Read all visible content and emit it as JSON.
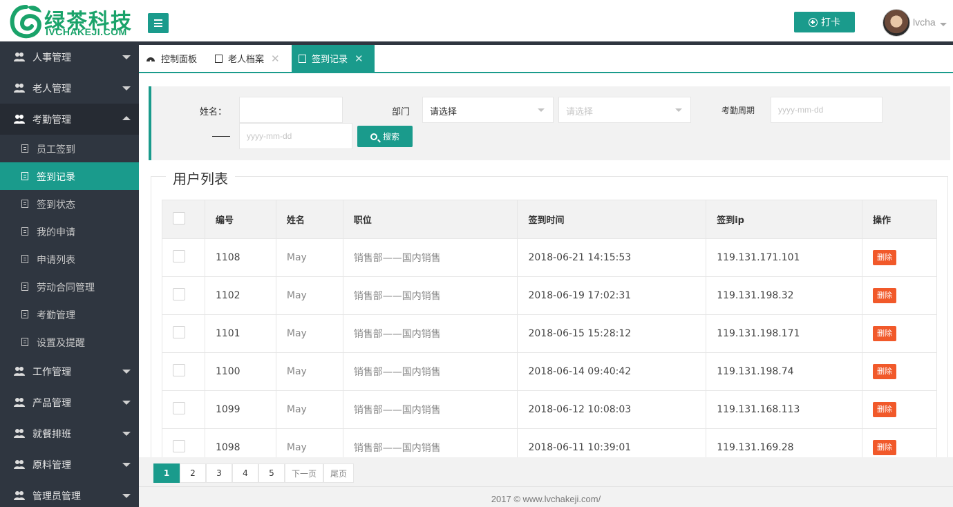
{
  "brand": {
    "name_cn": "绿茶科技",
    "name_en": "IVCHAKEJI.COM",
    "color": "#1aa36a"
  },
  "accent": "#1a9b8c",
  "header": {
    "punch_label": "打卡",
    "username": "lvcha"
  },
  "sidebar": {
    "groups": [
      {
        "label": "人事管理"
      },
      {
        "label": "老人管理"
      },
      {
        "label": "考勤管理"
      },
      {
        "label": "工作管理"
      },
      {
        "label": "产品管理"
      },
      {
        "label": "就餐排班"
      },
      {
        "label": "原料管理"
      },
      {
        "label": "管理员管理"
      }
    ],
    "sub_items": [
      {
        "label": "员工签到"
      },
      {
        "label": "签到记录"
      },
      {
        "label": "签到状态"
      },
      {
        "label": "我的申请"
      },
      {
        "label": "申请列表"
      },
      {
        "label": "劳动合同管理"
      },
      {
        "label": "考勤管理"
      },
      {
        "label": "设置及提醒"
      }
    ]
  },
  "tabs": [
    {
      "label": "控制面板"
    },
    {
      "label": "老人档案"
    },
    {
      "label": "签到记录"
    }
  ],
  "search": {
    "name_label": "姓名：",
    "name_value": "",
    "dept_label": "部门",
    "dept_select_1": "请选择",
    "dept_select_2": "请选择",
    "period_label": "考勤周期",
    "date_placeholder": "yyyy-mm-dd",
    "range_separator": "—",
    "search_label": "搜索"
  },
  "list": {
    "title": "用户列表",
    "columns": [
      "编号",
      "姓名",
      "职位",
      "签到时间",
      "签到ip",
      "操作"
    ],
    "rows": [
      {
        "id": "1108",
        "name": "May",
        "position": "销售部——国内销售",
        "time": "2018-06-21 14:15:53",
        "ip": "119.131.171.101",
        "action": "删除"
      },
      {
        "id": "1102",
        "name": "May",
        "position": "销售部——国内销售",
        "time": "2018-06-19 17:02:31",
        "ip": "119.131.198.32",
        "action": "删除"
      },
      {
        "id": "1101",
        "name": "May",
        "position": "销售部——国内销售",
        "time": "2018-06-15 15:28:12",
        "ip": "119.131.198.171",
        "action": "删除"
      },
      {
        "id": "1100",
        "name": "May",
        "position": "销售部——国内销售",
        "time": "2018-06-14 09:40:42",
        "ip": "119.131.198.74",
        "action": "删除"
      },
      {
        "id": "1099",
        "name": "May",
        "position": "销售部——国内销售",
        "time": "2018-06-12 10:08:03",
        "ip": "119.131.168.113",
        "action": "删除"
      },
      {
        "id": "1098",
        "name": "May",
        "position": "销售部——国内销售",
        "time": "2018-06-11 10:39:01",
        "ip": "119.131.169.28",
        "action": "删除"
      }
    ]
  },
  "pagination": {
    "pages": [
      "1",
      "2",
      "3",
      "4",
      "5"
    ],
    "current": "1",
    "next_label": "下一页",
    "last_label": "尾页"
  },
  "footer": {
    "text": "2017 ©  www.lvchakeji.com/"
  }
}
